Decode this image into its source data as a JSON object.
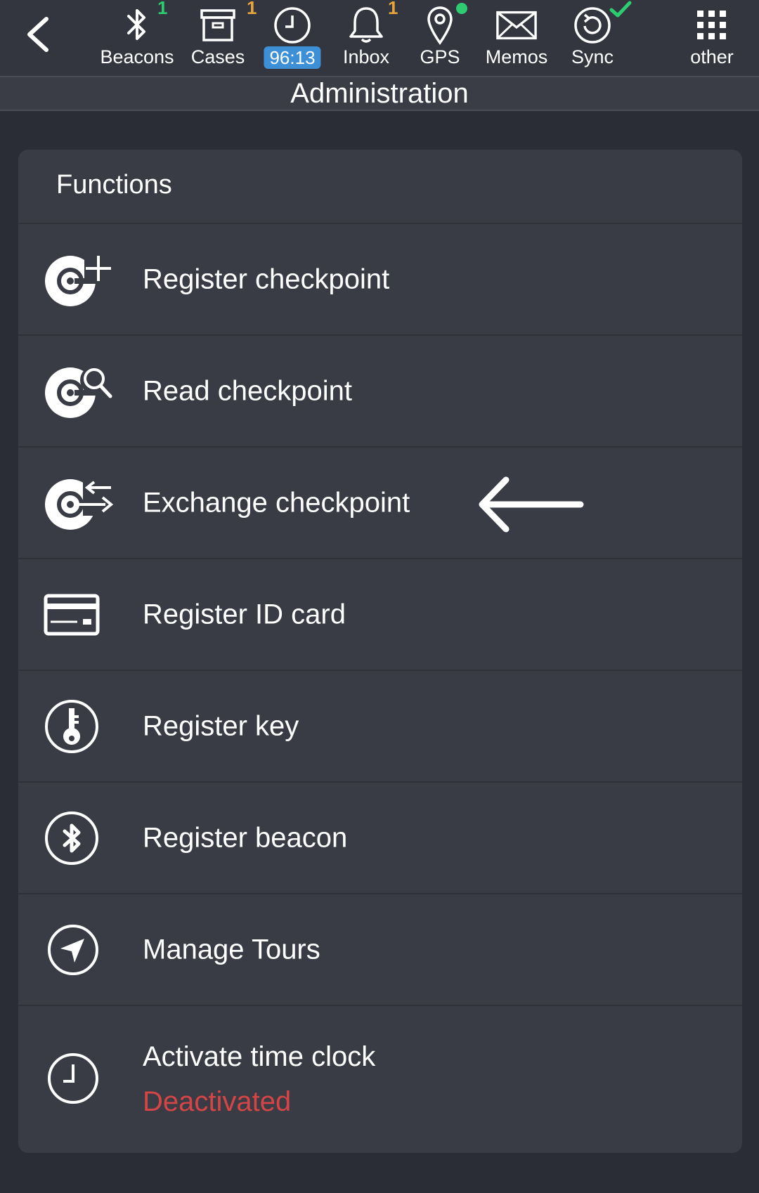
{
  "toolbar": {
    "items": [
      {
        "label": "Beacons",
        "badge": "1",
        "badge_color": "#2ecc71"
      },
      {
        "label": "Cases",
        "badge": "1",
        "badge_color": "#e8a63a"
      },
      {
        "timer": "96:13"
      },
      {
        "label": "Inbox",
        "badge": "1",
        "badge_color": "#e8a63a"
      },
      {
        "label": "GPS",
        "status_color": "#2ecc71"
      },
      {
        "label": "Memos"
      },
      {
        "label": "Sync",
        "status_color": "#2ecc71"
      },
      {
        "label": "other"
      }
    ]
  },
  "title": "Administration",
  "card": {
    "header": "Functions",
    "rows": [
      {
        "label": "Register checkpoint",
        "icon": "register-checkpoint-icon"
      },
      {
        "label": "Read checkpoint",
        "icon": "read-checkpoint-icon"
      },
      {
        "label": "Exchange checkpoint",
        "icon": "exchange-checkpoint-icon"
      },
      {
        "label": "Register ID card",
        "icon": "id-card-icon"
      },
      {
        "label": "Register key",
        "icon": "key-icon"
      },
      {
        "label": "Register beacon",
        "icon": "bluetooth-icon"
      },
      {
        "label": "Manage Tours",
        "icon": "navigation-icon"
      },
      {
        "label": "Activate time clock",
        "sublabel": "Deactivated",
        "sublabel_color": "#d64545",
        "icon": "clock-icon"
      }
    ]
  }
}
